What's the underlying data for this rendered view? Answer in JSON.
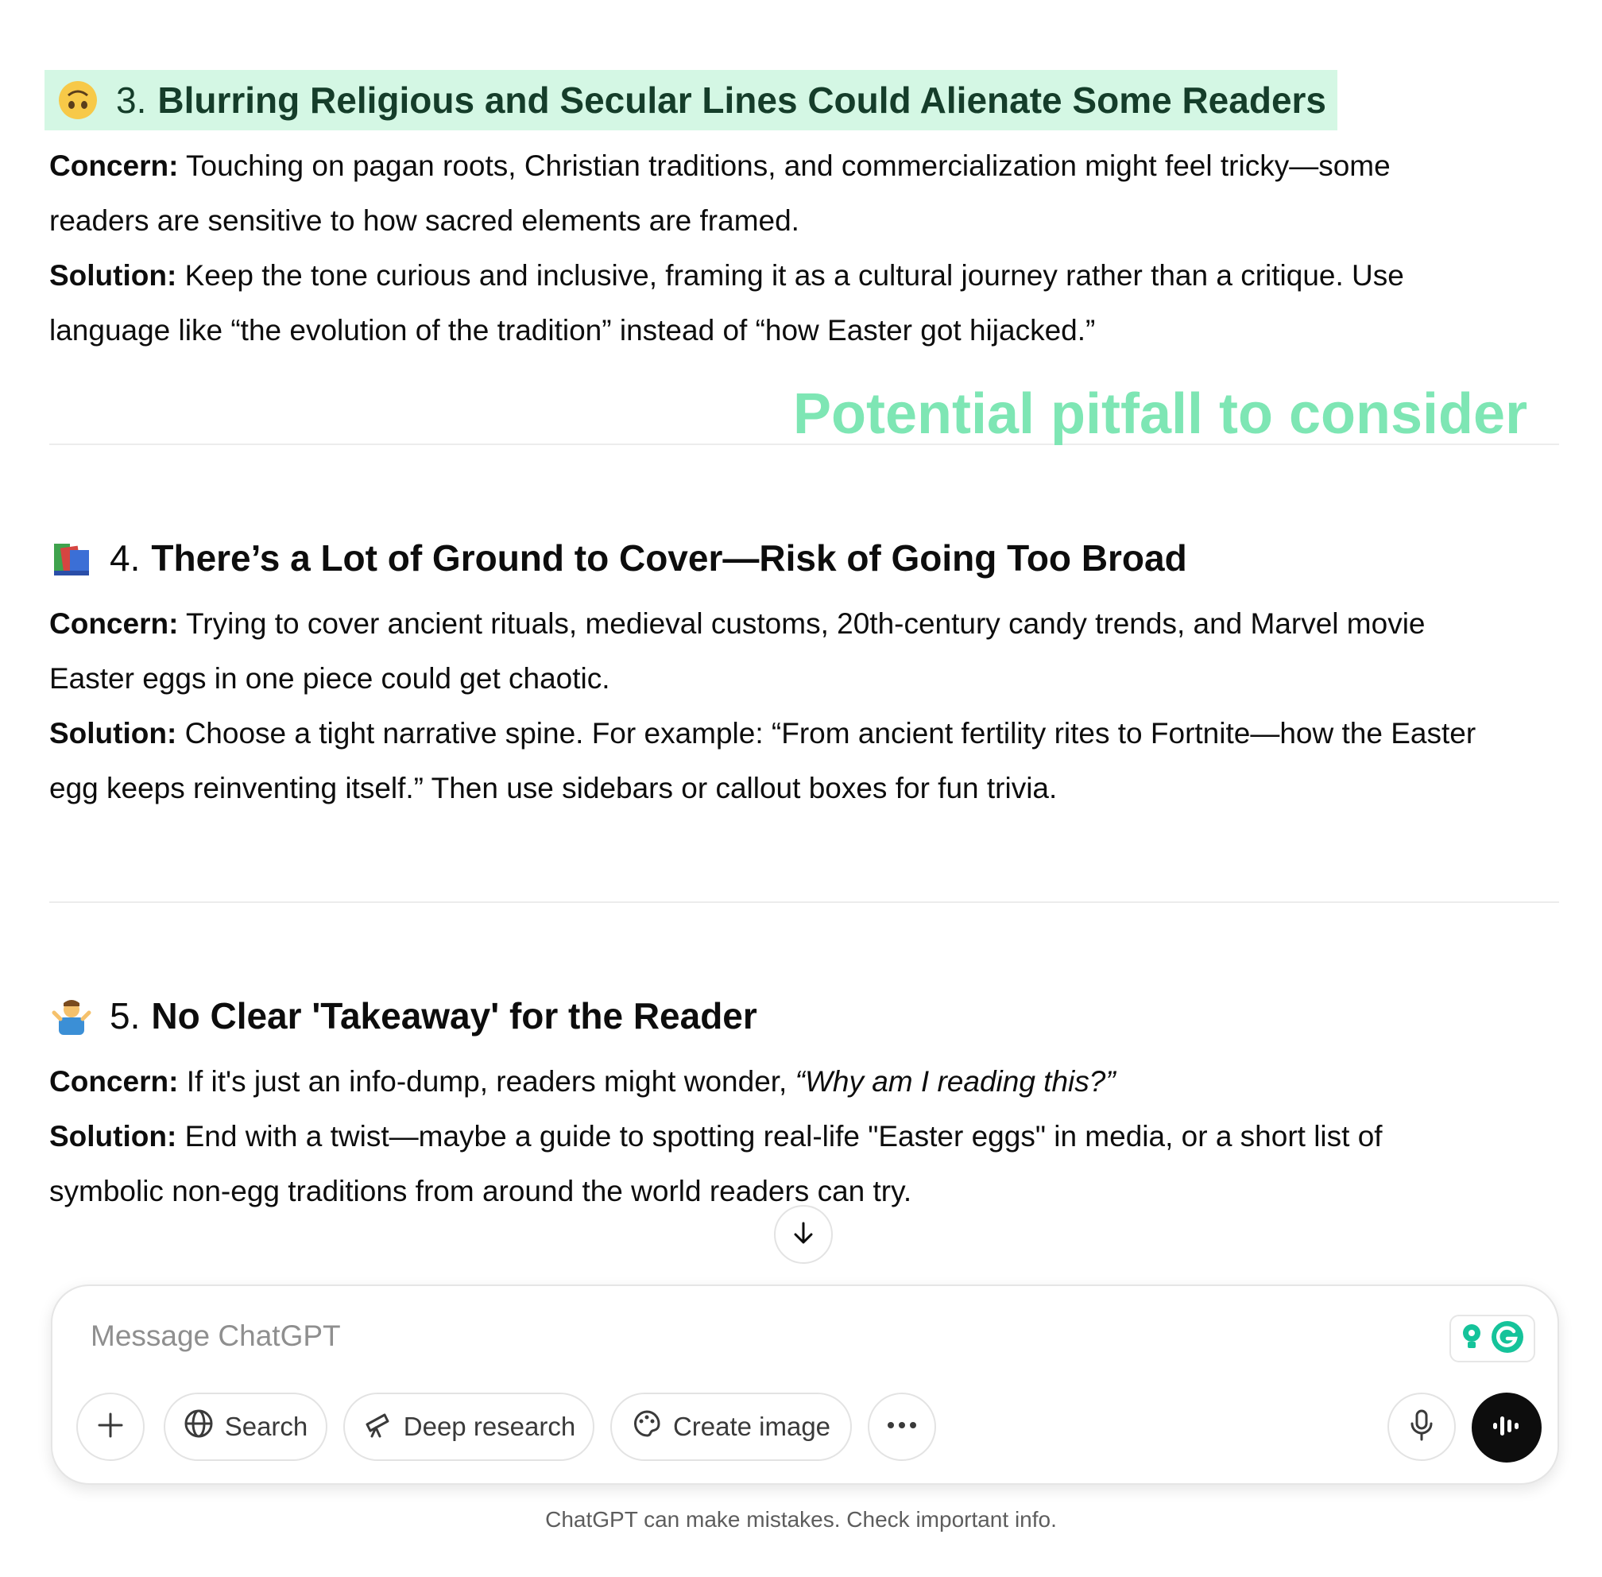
{
  "sections": [
    {
      "number": "3.",
      "title": "Blurring Religious and Secular Lines Could Alienate Some Readers",
      "emoji_icon": "upside-down-face-icon",
      "concern_label": "Concern:",
      "concern_line1": "Touching on pagan roots, Christian traditions, and commercialization might feel tricky—some",
      "concern_line2": "readers are sensitive to how sacred elements are framed.",
      "solution_label": "Solution:",
      "solution_line1": "Keep the tone curious and inclusive, framing it as a cultural journey rather than a critique. Use",
      "solution_line2": "language like “the evolution of the tradition” instead of “how Easter got hijacked.”"
    },
    {
      "number": "4.",
      "title": "There’s a Lot of Ground to Cover—Risk of Going Too Broad",
      "emoji_icon": "books-icon",
      "concern_label": "Concern:",
      "concern_line1": "Trying to cover ancient rituals, medieval customs, 20th-century candy trends, and Marvel movie",
      "concern_line2": "Easter eggs in one piece could get chaotic.",
      "solution_label": "Solution:",
      "solution_line1": "Choose a tight narrative spine. For example: “From ancient fertility rites to Fortnite—how the Easter",
      "solution_line2": "egg keeps reinventing itself.” Then use sidebars or callout boxes for fun trivia."
    },
    {
      "number": "5.",
      "title": "No Clear 'Takeaway' for the Reader",
      "emoji_icon": "person-shrugging-icon",
      "concern_label": "Concern:",
      "concern_text": "If it's just an info-dump, readers might wonder,",
      "concern_italic": "“Why am I reading this?”",
      "solution_label": "Solution:",
      "solution_line1": "End with a twist—maybe a guide to spotting real-life \"Easter eggs\" in media, or a short list of",
      "solution_line2": "symbolic non-egg traditions from around the world readers can try."
    }
  ],
  "annotation": "Potential pitfall to consider",
  "colors": {
    "highlight_bg": "#d4f7e4",
    "annotation": "#7ee6b4",
    "send_button": "#0d0d0d"
  },
  "composer": {
    "placeholder": "Message ChatGPT",
    "add_icon": "plus-icon",
    "search_label": "Search",
    "deep_research_label": "Deep research",
    "create_image_label": "Create image",
    "more_icon": "ellipsis-icon",
    "mic_icon": "microphone-icon",
    "voice_icon": "voice-mode-icon"
  },
  "footer": "ChatGPT can make mistakes. Check important info."
}
